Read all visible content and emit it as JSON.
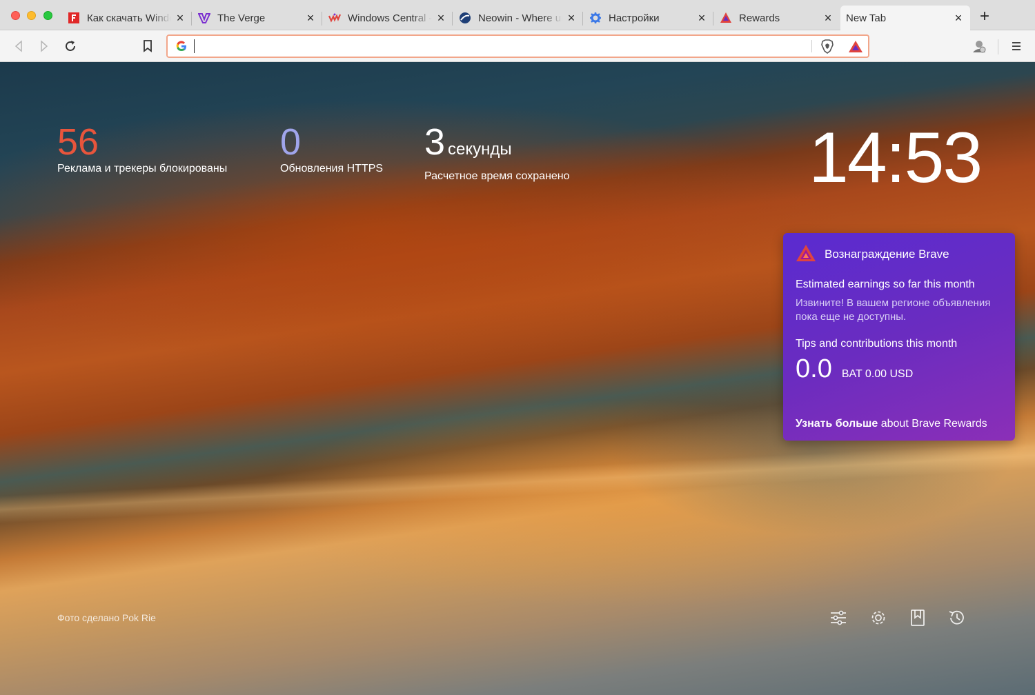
{
  "tabs": [
    {
      "title": "Как скачать Windo",
      "favicon": "file-icon-red",
      "active": false
    },
    {
      "title": "The Verge",
      "favicon": "verge-icon",
      "active": false
    },
    {
      "title": "Windows Central -",
      "favicon": "windows-central-icon",
      "active": false
    },
    {
      "title": "Neowin - Where un",
      "favicon": "neowin-icon",
      "active": false
    },
    {
      "title": "Настройки",
      "favicon": "gear-icon",
      "active": false
    },
    {
      "title": "Rewards",
      "favicon": "bat-triangle-icon",
      "active": false
    },
    {
      "title": "New Tab",
      "favicon": "",
      "active": true
    }
  ],
  "toolbar": {
    "url_value": "",
    "search_engine_icon": "google-icon"
  },
  "stats": {
    "ads": {
      "value": "56",
      "label": "Реклама и трекеры блокированы",
      "color": "#e8553c"
    },
    "https": {
      "value": "0",
      "label": "Обновления HTTPS",
      "color": "#a0a5eb"
    },
    "time": {
      "value": "3",
      "unit": "секунды",
      "label": "Расчетное время сохранено"
    }
  },
  "clock": "14:53",
  "rewards": {
    "title": "Вознаграждение Brave",
    "earnings_label": "Estimated earnings so far this month",
    "earnings_note": "Извините! В вашем регионе объявления пока еще не доступны.",
    "tips_label": "Tips and contributions this month",
    "bat_amount": "0.0",
    "usd_amount": "BAT 0.00 USD",
    "learn_more_bold": "Узнать больше",
    "learn_more_rest": "about Brave Rewards"
  },
  "photo_credit": "Фото сделано Pok Rie",
  "bottom_icons": [
    "customize-icon",
    "settings-icon",
    "bookmarks-icon",
    "history-icon"
  ]
}
